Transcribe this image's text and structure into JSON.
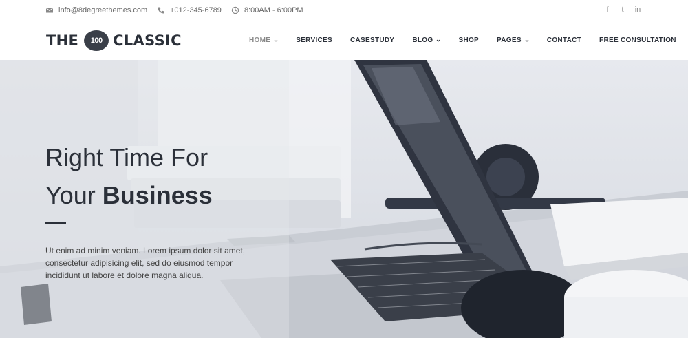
{
  "topbar": {
    "email": "info@8degreethemes.com",
    "phone": "+012-345-6789",
    "hours": "8:00AM - 6:00PM",
    "icons": {
      "email": "envelope-icon",
      "phone": "phone-icon",
      "hours": "clock-icon"
    },
    "social": [
      {
        "name": "facebook-icon",
        "glyph": "f"
      },
      {
        "name": "twitter-icon",
        "glyph": "t"
      },
      {
        "name": "linkedin-icon",
        "glyph": "in"
      }
    ]
  },
  "logo": {
    "left": "THE",
    "badge": "100",
    "right": "CLASSIC"
  },
  "nav": {
    "home": "HOME",
    "services": "SERVICES",
    "casestudy": "CASESTUDY",
    "blog": "BLOG",
    "shop": "SHOP",
    "pages": "PAGES",
    "contact": "CONTACT",
    "consultation": "FREE CONSULTATION"
  },
  "hero": {
    "line1": "Right Time For",
    "line2_plain": "Your ",
    "line2_bold": "Business",
    "text": "Ut enim ad minim veniam. Lorem ipsum dolor sit amet, consectetur adipisicing elit, sed do eiusmod tempor incididunt ut labore et dolore magna aliqua."
  },
  "colors": {
    "dark": "#2b3039",
    "muted": "#888888",
    "hero_bg": "#e1e4ea"
  }
}
